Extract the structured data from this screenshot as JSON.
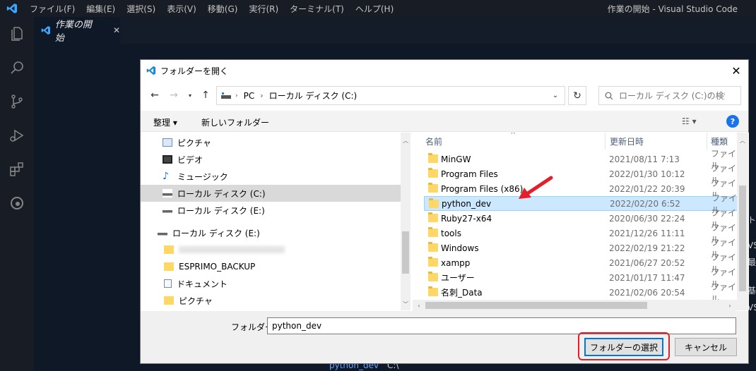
{
  "app": {
    "window_title": "作業の開始 - Visual Studio Code",
    "menu": [
      "ファイル(F)",
      "編集(E)",
      "選択(S)",
      "表示(V)",
      "移動(G)",
      "実行(R)",
      "ターミナル(T)",
      "ヘルプ(H)"
    ],
    "tab_label": "作業の開始",
    "activity_icons": [
      "explorer-icon",
      "search-icon",
      "source-control-icon",
      "run-debug-icon",
      "extensions-icon",
      "edge-icon"
    ],
    "bg_bottom_link": "python_dev",
    "bg_bottom_path": "C:\\",
    "bg_right_fragments": [
      "ト",
      "VS",
      "最",
      "基",
      "VS"
    ]
  },
  "dialog": {
    "title": "フォルダーを開く",
    "breadcrumb": [
      "PC",
      "ローカル ディスク (C:)"
    ],
    "search_placeholder": "ローカル ディスク (C:)の検索",
    "toolbar": {
      "organize": "整理 ▾",
      "new_folder": "新しいフォルダー",
      "help": "?"
    },
    "tree_items": [
      {
        "label": "ピクチャ",
        "icon": "pictures-icon",
        "indent": 1,
        "selected": false
      },
      {
        "label": "ビデオ",
        "icon": "video-icon",
        "indent": 1,
        "selected": false
      },
      {
        "label": "ミュージック",
        "icon": "music-icon",
        "indent": 1,
        "selected": false
      },
      {
        "label": "ローカル ディスク (C:)",
        "icon": "drive-icon",
        "indent": 1,
        "selected": true
      },
      {
        "label": "ローカル ディスク (E:)",
        "icon": "drive-icon",
        "indent": 1,
        "selected": false
      },
      {
        "label": "ローカル ディスク (E:)",
        "icon": "drive-icon",
        "indent": 0,
        "selected": false
      },
      {
        "label": "",
        "icon": "folder-icon",
        "indent": 1,
        "selected": false,
        "blurred": true
      },
      {
        "label": "ESPRIMO_BACKUP",
        "icon": "folder-icon",
        "indent": 1,
        "selected": false
      },
      {
        "label": "ドキュメント",
        "icon": "document-icon",
        "indent": 1,
        "selected": false
      },
      {
        "label": "ピクチャ",
        "icon": "folder-icon",
        "indent": 1,
        "selected": false
      }
    ],
    "columns": {
      "name": "名前",
      "date": "更新日時",
      "type": "種類"
    },
    "files": [
      {
        "name": "MinGW",
        "date": "2021/08/11 7:13",
        "type": "ファイル",
        "selected": false
      },
      {
        "name": "Program Files",
        "date": "2022/01/30 10:12",
        "type": "ファイル",
        "selected": false
      },
      {
        "name": "Program Files (x86)",
        "date": "2022/01/22 20:39",
        "type": "ファイル",
        "selected": false
      },
      {
        "name": "python_dev",
        "date": "2022/02/20 6:52",
        "type": "ファイル",
        "selected": true
      },
      {
        "name": "Ruby27-x64",
        "date": "2020/06/30 22:24",
        "type": "ファイル",
        "selected": false
      },
      {
        "name": "tools",
        "date": "2021/12/26 11:11",
        "type": "ファイル",
        "selected": false
      },
      {
        "name": "Windows",
        "date": "2022/02/19 21:22",
        "type": "ファイル",
        "selected": false
      },
      {
        "name": "xampp",
        "date": "2021/06/27 20:52",
        "type": "ファイル",
        "selected": false
      },
      {
        "name": "ユーザー",
        "date": "2021/01/17 11:47",
        "type": "ファイル",
        "selected": false
      },
      {
        "name": "名刺_Data",
        "date": "2021/02/06 20:54",
        "type": "ファイル",
        "selected": false
      }
    ],
    "folder_label": "フォルダー:",
    "folder_value": "python_dev",
    "select_button": "フォルダーの選択",
    "cancel_button": "キャンセル"
  },
  "colors": {
    "accent": "#0078d7",
    "annotation_red": "#e21f2a",
    "selected_row": "#cce8ff",
    "vscode_blue": "#3ea6ff"
  }
}
